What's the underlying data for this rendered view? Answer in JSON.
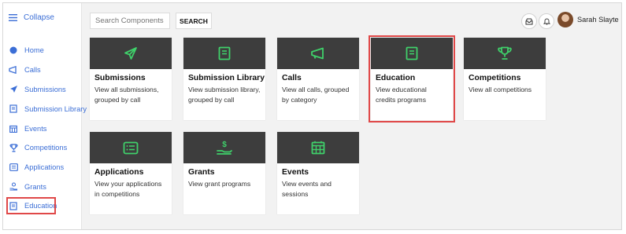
{
  "sidebar": {
    "collapse_label": "Collapse",
    "items": [
      {
        "label": "Home",
        "icon": "home-dot-icon"
      },
      {
        "label": "Calls",
        "icon": "megaphone-icon"
      },
      {
        "label": "Submissions",
        "icon": "paper-plane-icon"
      },
      {
        "label": "Submission Library",
        "icon": "book-icon"
      },
      {
        "label": "Events",
        "icon": "calendar-icon"
      },
      {
        "label": "Competitions",
        "icon": "trophy-icon"
      },
      {
        "label": "Applications",
        "icon": "list-icon"
      },
      {
        "label": "Grants",
        "icon": "grant-hand-icon"
      },
      {
        "label": "Education",
        "icon": "book-icon"
      }
    ]
  },
  "header": {
    "search_placeholder": "Search Components",
    "search_button": "SEARCH",
    "user_name": "Sarah Slayte"
  },
  "cards": [
    {
      "title": "Submissions",
      "desc": "View all submissions, grouped by call",
      "icon": "paper-plane-icon"
    },
    {
      "title": "Submission Library",
      "desc": "View submission library, grouped by call",
      "icon": "book-icon"
    },
    {
      "title": "Calls",
      "desc": "View all calls, grouped by category",
      "icon": "megaphone-icon"
    },
    {
      "title": "Education",
      "desc": "View educational credits programs",
      "icon": "book-icon"
    },
    {
      "title": "Competitions",
      "desc": "View all competitions",
      "icon": "trophy-icon"
    },
    {
      "title": "Applications",
      "desc": "View your applications in competitions",
      "icon": "list-icon"
    },
    {
      "title": "Grants",
      "desc": "View grant programs",
      "icon": "grant-hand-icon"
    },
    {
      "title": "Events",
      "desc": "View events and sessions",
      "icon": "calendar-icon"
    }
  ],
  "colors": {
    "accent": "#3b6ed6",
    "icon_green": "#3fd06a",
    "card_header": "#3d3d3d",
    "highlight": "#e04848"
  }
}
